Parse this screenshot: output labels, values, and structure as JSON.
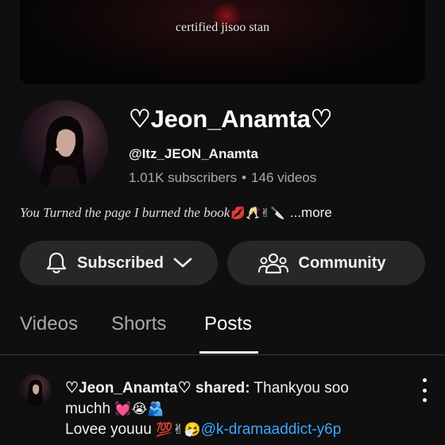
{
  "banner": {
    "text": "certified jisoo stan"
  },
  "channel": {
    "name": "♡Jeon_Anamta♡",
    "handle": "@Itz_JEON_Anamta",
    "subscribers": "1.01K subscribers",
    "separator": "•",
    "videos": "146 videos",
    "bio": "You Turned the page I burned the book",
    "bio_emojis": "💋🥂✌🔪",
    "more_label": "...more"
  },
  "actions": {
    "subscribed_label": "Subscribed",
    "community_label": "Community"
  },
  "tabs": [
    {
      "label": "Videos",
      "active": false
    },
    {
      "label": "Shorts",
      "active": false
    },
    {
      "label": "Posts",
      "active": true
    }
  ],
  "post": {
    "author": "♡Jeon_Anamta♡",
    "shared_label": "shared:",
    "text_line1": "Thankyou soo",
    "text_line2": "muchh",
    "emojis_line2": "💓😭🫂",
    "text_line3": "Lovee youuu",
    "emojis_line3": "💯✌🤧",
    "mention": "@k-dramaaddict-y6p"
  },
  "icons": {
    "subscribed": "bell-icon",
    "subscribed_dropdown": "chevron-down-icon",
    "community": "people-icon",
    "post_menu": "more-vertical-icon"
  },
  "colors": {
    "background": "#0f0f0f",
    "button_bg": "#272727",
    "secondary_text": "#aaaaaa",
    "mention": "#3ea6ff"
  }
}
